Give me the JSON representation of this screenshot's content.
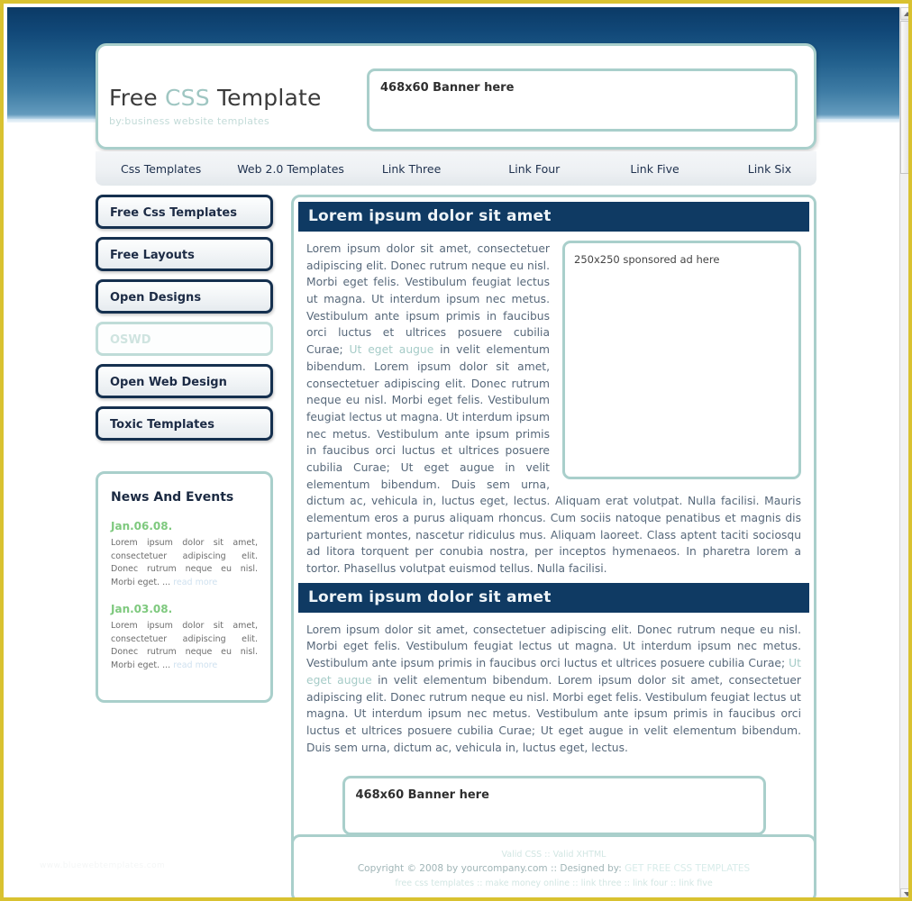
{
  "header": {
    "logo_title_part1": "Free ",
    "logo_title_css": "CSS",
    "logo_title_part2": " Template",
    "logo_subtitle": "by:business website templates",
    "banner_label": "468x60 Banner here"
  },
  "nav": {
    "items": [
      {
        "label": "Css Templates"
      },
      {
        "label": "Web 2.0 Templates"
      },
      {
        "label": "Link Three"
      },
      {
        "label": "Link Four"
      },
      {
        "label": "Link Five"
      },
      {
        "label": "Link Six"
      }
    ]
  },
  "sidebar": {
    "menu": [
      {
        "label": "Free Css Templates",
        "muted": false
      },
      {
        "label": "Free Layouts",
        "muted": false
      },
      {
        "label": "Open Designs",
        "muted": false
      },
      {
        "label": "OSWD",
        "muted": true
      },
      {
        "label": "Open Web Design",
        "muted": false
      },
      {
        "label": "Toxic Templates",
        "muted": false
      }
    ],
    "news": {
      "title": "News And Events",
      "entries": [
        {
          "date": "Jan.06.08.",
          "text": "Lorem ipsum dolor sit amet, consectetuer adipiscing elit. Donec rutrum neque eu nisl. Morbi eget. ...",
          "read_more": "read more"
        },
        {
          "date": "Jan.03.08.",
          "text": "Lorem ipsum dolor sit amet, consectetuer adipiscing elit. Donec rutrum neque eu nisl. Morbi eget. ...",
          "read_more": "read more"
        }
      ]
    }
  },
  "main": {
    "section1": {
      "heading": "Lorem ipsum dolor sit amet",
      "ad_label": "250x250 sponsored ad here",
      "para1_a": "Lorem ipsum dolor sit amet, consectetuer adipiscing elit. Donec rutrum neque eu nisl. Morbi eget felis. Vestibulum feugiat lectus ut magna. Ut interdum ipsum nec metus. Vestibulum ante ipsum primis in faucibus orci luctus et ultrices posuere cubilia Curae; ",
      "para1_link": "Ut eget augue",
      "para1_b": " in velit elementum bibendum. Lorem ipsum dolor sit amet, consectetuer adipiscing elit. Donec rutrum neque eu nisl. Morbi eget felis. Vestibulum feugiat lectus ut magna. Ut interdum ipsum nec metus. Vestibulum ante ipsum primis in faucibus orci luctus et ultrices posuere cubilia Curae; Ut eget augue in velit elementum bibendum. Duis sem urna, dictum ac, vehicula in, luctus eget, lectus. Aliquam erat volutpat. Nulla facilisi. Mauris elementum eros a purus aliquam rhoncus. Cum sociis natoque penatibus et magnis dis parturient montes, nascetur ridiculus mus. Aliquam laoreet. Class aptent taciti sociosqu ad litora torquent per conubia nostra, per inceptos hymenaeos. In pharetra lorem a tortor. Phasellus volutpat euismod tellus. Nulla facilisi."
    },
    "section2": {
      "heading": "Lorem ipsum dolor sit amet",
      "para_a": "Lorem ipsum dolor sit amet, consectetuer adipiscing elit. Donec rutrum neque eu nisl. Morbi eget felis. Vestibulum feugiat lectus ut magna. Ut interdum ipsum nec metus. Vestibulum ante ipsum primis in faucibus orci luctus et ultrices posuere cubilia Curae; ",
      "para_link": "Ut eget augue",
      "para_b": " in velit elementum bibendum. Lorem ipsum dolor sit amet, consectetuer adipiscing elit. Donec rutrum neque eu nisl. Morbi eget felis. Vestibulum feugiat lectus ut magna. Ut interdum ipsum nec metus. Vestibulum ante ipsum primis in faucibus orci luctus et ultrices posuere cubilia Curae; Ut eget augue in velit elementum bibendum. Duis sem urna, dictum ac, vehicula in, luctus eget, lectus.",
      "banner_label": "468x60 Banner here"
    }
  },
  "footer": {
    "valid_css": "Valid CSS",
    "sep1": " :: ",
    "valid_xhtml": "Valid XHTML",
    "copyright": "Copyright © 2008 by yourcompany.com :: Designed by: ",
    "designer_link": "GET FREE CSS TEMPLATES",
    "links": [
      "free css templates",
      "make money online",
      "link three",
      "link four",
      "link five"
    ],
    "link_sep": " :: "
  },
  "watermark": "www.bluewebtemplates.com",
  "colors": {
    "accent_teal": "#a9cfcb",
    "heading_navy": "#0f3a63",
    "menu_border": "#15304f",
    "news_green": "#7ec97e",
    "frame_gold": "#d9c230"
  }
}
